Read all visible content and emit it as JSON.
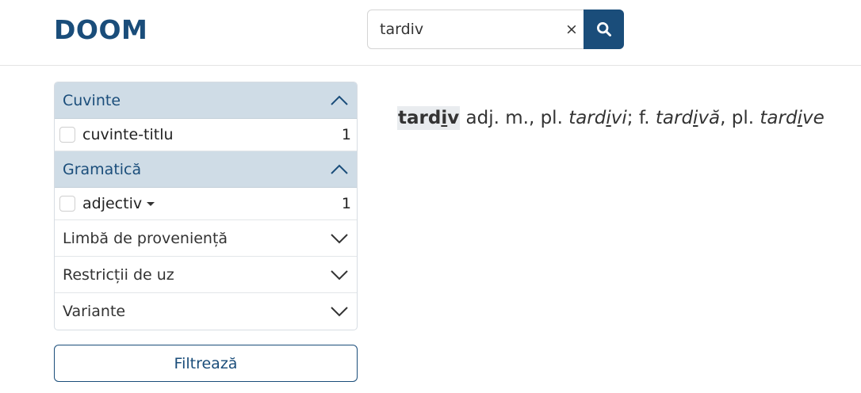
{
  "header": {
    "logo": "DOOM"
  },
  "search": {
    "value": "tardiv",
    "clear_label": "×",
    "button_icon": "search-icon"
  },
  "filters": {
    "cuvinte": {
      "title": "Cuvinte",
      "items": [
        {
          "label": "cuvinte-titlu",
          "count": "1"
        }
      ]
    },
    "gramatica": {
      "title": "Gramatică",
      "items": [
        {
          "label": "adjectiv",
          "count": "1"
        }
      ]
    },
    "collapsed": [
      {
        "title": "Limbă de proveniență"
      },
      {
        "title": "Restricții de uz"
      },
      {
        "title": "Variante"
      }
    ]
  },
  "filter_button": {
    "label": "Filtrează"
  },
  "entry": {
    "headword_prefix": "tard",
    "headword_stress": "i",
    "headword_suffix": "v",
    "pos": " adj. m., pl. ",
    "plural_m_prefix": "tard",
    "plural_m_stress": "i",
    "plural_m_suffix": "vi",
    "fem_sep": "; f. ",
    "fem_prefix": "tard",
    "fem_stress": "i",
    "fem_suffix": "vă",
    "pl_sep": ", pl. ",
    "plural_f_prefix": "tard",
    "plural_f_stress": "i",
    "plural_f_suffix": "ve"
  },
  "colors": {
    "brand": "#1a4d7a",
    "panel_header_bg": "#cfdce6"
  }
}
